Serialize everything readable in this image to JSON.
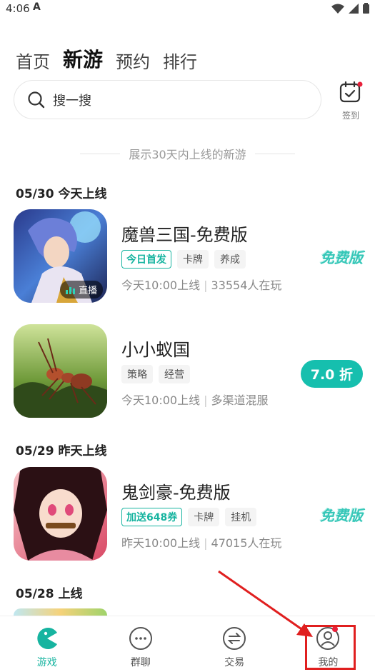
{
  "status_bar": {
    "time": "4:06",
    "app_glyph": "A"
  },
  "top_tabs": [
    {
      "label": "首页",
      "active": false
    },
    {
      "label": "新游",
      "active": true
    },
    {
      "label": "预约",
      "active": false
    },
    {
      "label": "排行",
      "active": false
    }
  ],
  "search": {
    "placeholder": "搜一搜"
  },
  "signin": {
    "label": "签到"
  },
  "notice": "展示30天内上线的新游",
  "sections": [
    {
      "date": "05/30 今天上线"
    },
    {
      "date": "05/29 昨天上线"
    },
    {
      "date": "05/28 上线"
    }
  ],
  "games": [
    {
      "title": "魔兽三国-免费版",
      "tags": [
        {
          "label": "今日首发",
          "highlight": true
        },
        {
          "label": "卡牌",
          "highlight": false
        },
        {
          "label": "养成",
          "highlight": false
        }
      ],
      "release": "今天10:00上线",
      "extra": "33554人在玩",
      "badge": "免费版",
      "live": "直播"
    },
    {
      "title": "小小蚁国",
      "tags": [
        {
          "label": "策略",
          "highlight": false
        },
        {
          "label": "经营",
          "highlight": false
        }
      ],
      "release": "今天10:00上线",
      "extra": "多渠道混服",
      "badge": "7.0 折"
    },
    {
      "title": "鬼剑豪-免费版",
      "tags": [
        {
          "label": "加送648券",
          "highlight": true
        },
        {
          "label": "卡牌",
          "highlight": false
        },
        {
          "label": "挂机",
          "highlight": false
        }
      ],
      "release": "昨天10:00上线",
      "extra": "47015人在玩",
      "badge": "免费版"
    }
  ],
  "bottom_nav": [
    {
      "label": "游戏",
      "icon": "game-pacman-icon",
      "active": true
    },
    {
      "label": "群聊",
      "icon": "chat-bubble-icon",
      "active": false
    },
    {
      "label": "交易",
      "icon": "exchange-icon",
      "active": false
    },
    {
      "label": "我的",
      "icon": "profile-icon",
      "active": false,
      "has_dot": true
    }
  ],
  "colors": {
    "accent": "#17b4a0",
    "annotation": "#e01f1f",
    "notification_dot": "#e8213b"
  }
}
